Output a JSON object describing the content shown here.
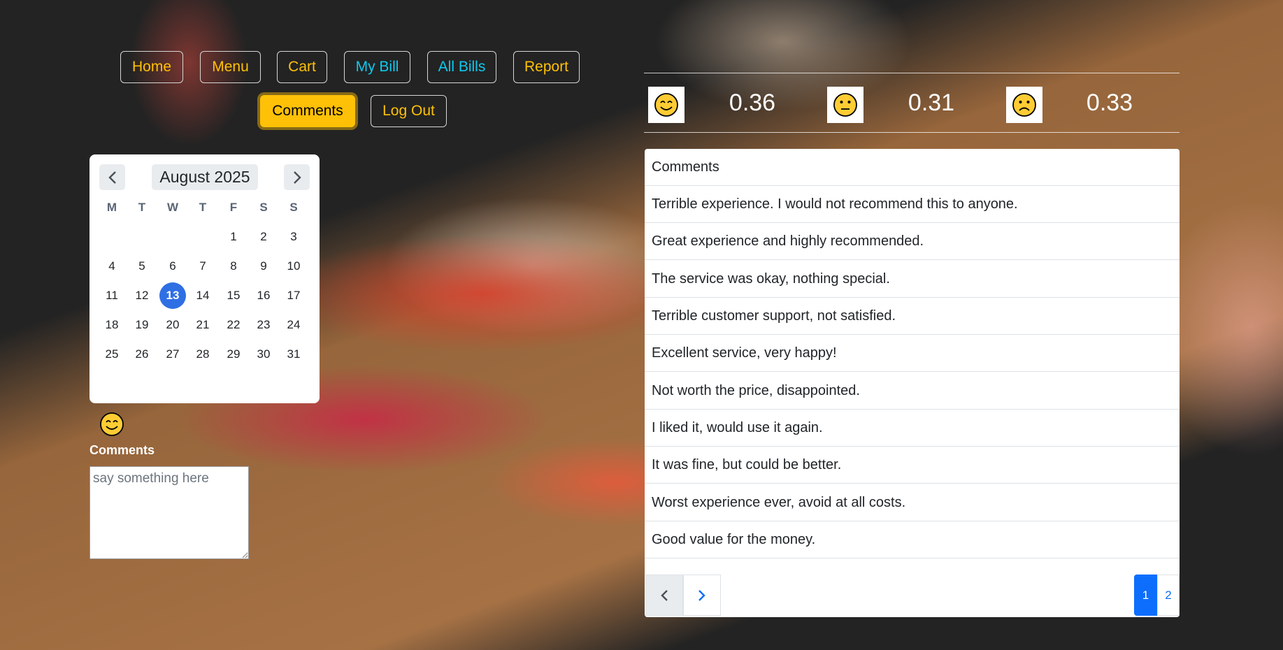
{
  "nav": {
    "home": "Home",
    "menu": "Menu",
    "cart": "Cart",
    "my_bill": "My Bill",
    "all_bills": "All Bills",
    "report": "Report",
    "comments": "Comments",
    "log_out": "Log Out"
  },
  "calendar": {
    "month_label": "August 2025",
    "weekdays": [
      "M",
      "T",
      "W",
      "T",
      "F",
      "S",
      "S"
    ],
    "weeks": [
      [
        "",
        "",
        "",
        "",
        "1",
        "2",
        "3"
      ],
      [
        "4",
        "5",
        "6",
        "7",
        "8",
        "9",
        "10"
      ],
      [
        "11",
        "12",
        "13",
        "14",
        "15",
        "16",
        "17"
      ],
      [
        "18",
        "19",
        "20",
        "21",
        "22",
        "23",
        "24"
      ],
      [
        "25",
        "26",
        "27",
        "28",
        "29",
        "30",
        "31"
      ]
    ],
    "selected_day": "13"
  },
  "comment_form": {
    "mood_icon": "smiling-face-icon",
    "label": "Comments",
    "placeholder": "say something here"
  },
  "sentiment": {
    "positive": {
      "icon": "smiling-face-icon",
      "value": "0.36"
    },
    "neutral": {
      "icon": "neutral-face-icon",
      "value": "0.31"
    },
    "negative": {
      "icon": "frowning-face-icon",
      "value": "0.33"
    }
  },
  "comments_panel": {
    "header": "Comments",
    "items": [
      "Terrible experience. I would not recommend this to anyone.",
      "Great experience and highly recommended.",
      "The service was okay, nothing special.",
      "Terrible customer support, not satisfied.",
      "Excellent service, very happy!",
      "Not worth the price, disappointed.",
      "I liked it, would use it again.",
      "It was fine, but could be better.",
      "Worst experience ever, avoid at all costs.",
      "Good value for the money."
    ],
    "pages": [
      "1",
      "2"
    ],
    "current_page": "1"
  },
  "colors": {
    "warning": "#ffc107",
    "info": "#0dcaf0",
    "primary": "#0d6efd",
    "calendar_selected": "#2f6fe4"
  }
}
